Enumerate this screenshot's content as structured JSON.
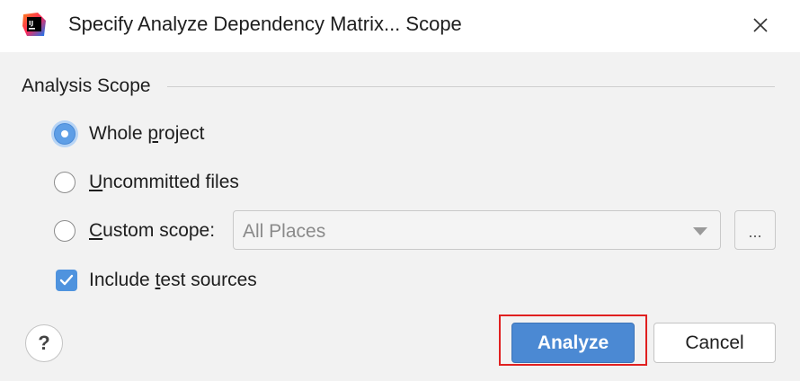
{
  "window": {
    "title": "Specify Analyze Dependency Matrix... Scope",
    "app_icon": "intellij-idea-icon",
    "close_icon": "close-icon"
  },
  "section": {
    "label": "Analysis Scope"
  },
  "options": {
    "whole_project": {
      "pre": "Whole ",
      "mn": "p",
      "post": "roject",
      "selected": true
    },
    "uncommitted": {
      "pre": "",
      "mn": "U",
      "post": "ncommitted files",
      "selected": false
    },
    "custom": {
      "pre": "",
      "mn": "C",
      "post": "ustom scope:",
      "selected": false
    }
  },
  "custom_scope": {
    "value": "All Places",
    "browse_label": "..."
  },
  "include_tests": {
    "pre": "Include ",
    "mn": "t",
    "post": "est sources",
    "checked": true
  },
  "buttons": {
    "help": "?",
    "analyze": "Analyze",
    "cancel": "Cancel"
  },
  "colors": {
    "primary": "#4b89d3",
    "highlight": "#e02020"
  }
}
